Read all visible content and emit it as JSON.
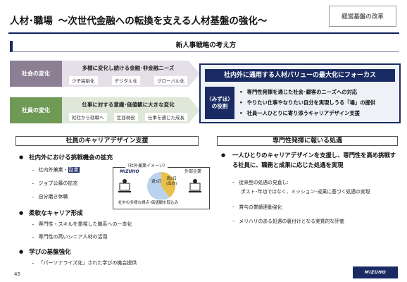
{
  "header": {
    "title": "人材･職場",
    "subtitle": "～次世代金融への転換を支える人材基盤の強化～",
    "tag": "経営基盤の改革"
  },
  "section": {
    "title": "新人事戦略の考え方"
  },
  "changes": [
    {
      "label": "社会の変化",
      "main": "多様に変化し続ける金融･非金融ニーズ",
      "chips": [
        "少子高齢化",
        "デジタル化",
        "グローバル化"
      ]
    },
    {
      "label": "社員の変化",
      "main": "仕事に対する意識･価値観に大きな変化",
      "chips": [
        "就社から就職へ",
        "生涯現役",
        "仕事を通じた成長"
      ]
    }
  ],
  "value_panel": {
    "heading": "社内外に通用する人材バリューの最大化にフォーカス",
    "role_line1": "〈みずほ〉",
    "role_line2": "の役割",
    "bullets": [
      "専門性発揮を通じた社会･顧客のニーズへの対応",
      "やりたい仕事やなりたい自分を実現しうる「場」の提供",
      "社員一人ひとりに寄り添うキャリアデザイン支援"
    ]
  },
  "left": {
    "heading": "社員のキャリアデザイン支援",
    "groups": [
      {
        "title": "社内外における挑戦機会の拡充",
        "items_prefix": "社内外兼業・",
        "items_highlight": "副業",
        "items": [
          "ジョブ公募の拡充",
          "自分磨き休職"
        ]
      },
      {
        "title": "柔軟なキャリア形成",
        "items": [
          "専門性・スキルを重視した職系への一本化",
          "専門性の高いシニア人材の活用"
        ]
      },
      {
        "title": "学びの基盤強化",
        "items": [
          "「パーソナライズ化」された学びの機会提供"
        ]
      }
    ],
    "figure": {
      "caption": "（社外兼業イメージ）",
      "company": "MIZUHO",
      "external": "外部企業",
      "inside_label": "週3日",
      "outside_label1": "週2日",
      "outside_label2": "(出向)",
      "footer": "社外の多様な視点･価値観を取込み",
      "share_days": [
        3,
        2
      ]
    }
  },
  "right": {
    "heading": "専門性発揮に報いる処遇",
    "main": "一人ひとりのキャリアデザインを支援し、専門性を高め挑戦する社員に、職務と成果に応じた処遇を実現",
    "items": [
      "従来型の処遇の見直し:",
      "ポスト･年功ではなく、ミッション･成果に基づく処遇の実現",
      "賞与の業績連動強化",
      "メリハリのある処遇の裏付けとなる実質的な評価"
    ]
  },
  "footer": {
    "page": "45",
    "logo": "MIZUHO"
  },
  "colors": {
    "navy": "#1a2b63",
    "society": "#8c7e93",
    "employee": "#6f9a55"
  }
}
